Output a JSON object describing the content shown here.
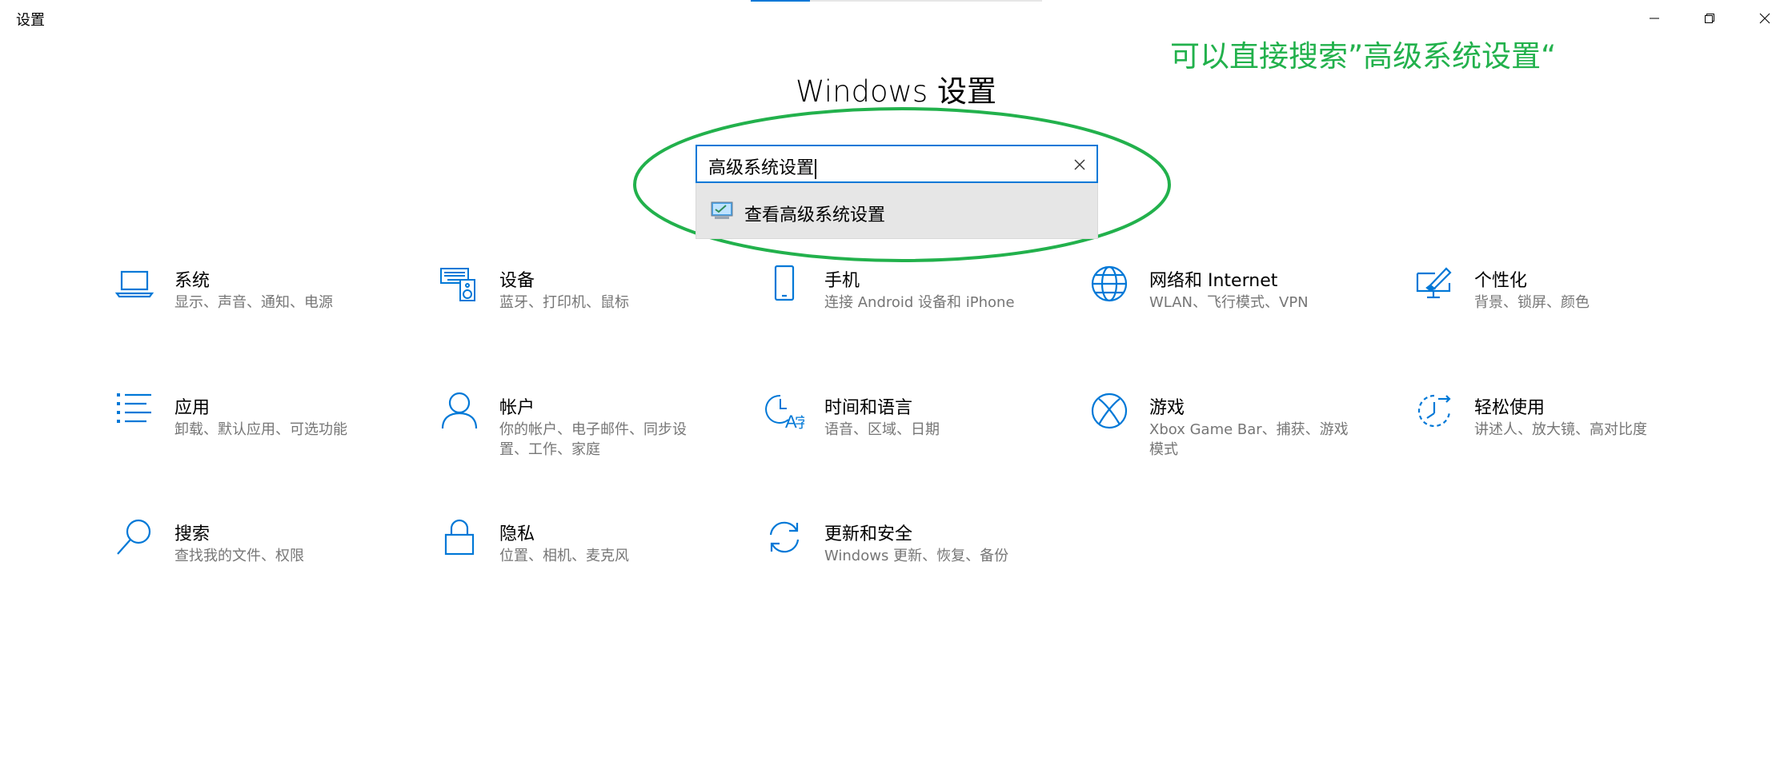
{
  "window": {
    "title": "设置",
    "controls": {
      "minimize_icon": "minimize-icon",
      "maximize_icon": "restore-icon",
      "close_icon": "close-icon"
    }
  },
  "header": {
    "title": "Windows 设置"
  },
  "search": {
    "value": "高级系统设置",
    "clear_icon": "close-icon",
    "suggestion": {
      "label": "查看高级系统设置",
      "icon": "control-panel-icon"
    }
  },
  "annotation": {
    "text": "可以直接搜索”高级系统设置“",
    "color": "#22b14c"
  },
  "colors": {
    "accent": "#0078d7",
    "secondary_text": "#767676",
    "suggestion_bg": "#e6e6e6"
  },
  "categories": [
    {
      "title": "系统",
      "desc": "显示、声音、通知、电源",
      "icon": "laptop-icon"
    },
    {
      "title": "设备",
      "desc": "蓝牙、打印机、鼠标",
      "icon": "keyboard-speaker-icon"
    },
    {
      "title": "手机",
      "desc": "连接 Android 设备和 iPhone",
      "icon": "phone-icon"
    },
    {
      "title": "网络和 Internet",
      "desc": "WLAN、飞行模式、VPN",
      "icon": "globe-icon"
    },
    {
      "title": "个性化",
      "desc": "背景、锁屏、颜色",
      "icon": "paint-screen-icon"
    },
    {
      "title": "应用",
      "desc": "卸载、默认应用、可选功能",
      "icon": "app-list-icon"
    },
    {
      "title": "帐户",
      "desc": "你的帐户、电子邮件、同步设置、工作、家庭",
      "icon": "person-icon"
    },
    {
      "title": "时间和语言",
      "desc": "语音、区域、日期",
      "icon": "time-language-icon"
    },
    {
      "title": "游戏",
      "desc": "Xbox Game Bar、捕获、游戏模式",
      "icon": "xbox-icon"
    },
    {
      "title": "轻松使用",
      "desc": "讲述人、放大镜、高对比度",
      "icon": "ease-of-access-icon"
    },
    {
      "title": "搜索",
      "desc": "查找我的文件、权限",
      "icon": "search-icon"
    },
    {
      "title": "隐私",
      "desc": "位置、相机、麦克风",
      "icon": "lock-icon"
    },
    {
      "title": "更新和安全",
      "desc": "Windows 更新、恢复、备份",
      "icon": "sync-icon"
    }
  ]
}
